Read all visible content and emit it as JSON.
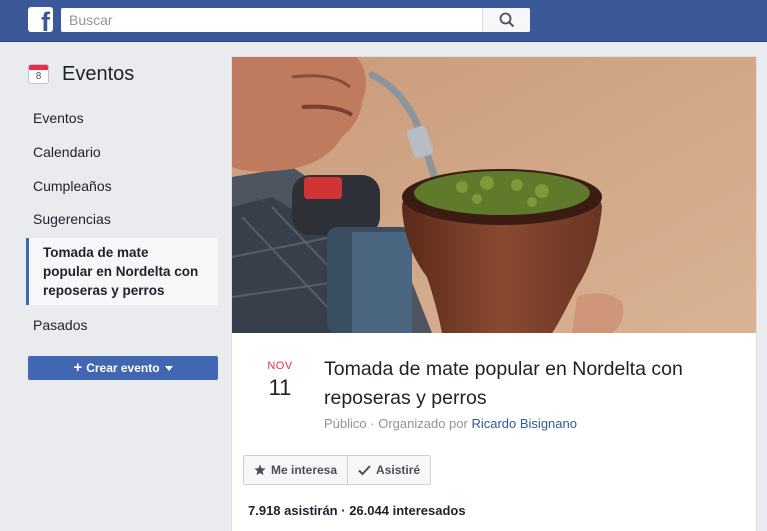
{
  "header": {
    "logo_letter": "f",
    "search_placeholder": "Buscar"
  },
  "sidebar": {
    "icon_day": "8",
    "title": "Eventos",
    "items": [
      {
        "label": "Eventos"
      },
      {
        "label": "Calendario"
      },
      {
        "label": "Cumpleaños"
      },
      {
        "label": "Sugerencias"
      }
    ],
    "active_lines": [
      "Tomada de mate",
      "popular en Nordelta con",
      "reposeras y perros"
    ],
    "after_item": "Pasados",
    "create_label": "Crear evento"
  },
  "event": {
    "month": "NOV",
    "day": "11",
    "title_lines": [
      "Tomada de mate popular en Nordelta con",
      "reposeras y perros"
    ],
    "visibility": "Público",
    "organized_prefix": "Organizado por",
    "organizer": "Ricardo Bisignano",
    "interested_label": "Me interesa",
    "going_label": "Asistiré",
    "going_count": "7.918 asistirán",
    "interested_count": "26.044 interesados"
  },
  "colors": {
    "topbar": "#3b5998",
    "accent": "#4267b2",
    "month": "#f02849",
    "link": "#365899"
  }
}
